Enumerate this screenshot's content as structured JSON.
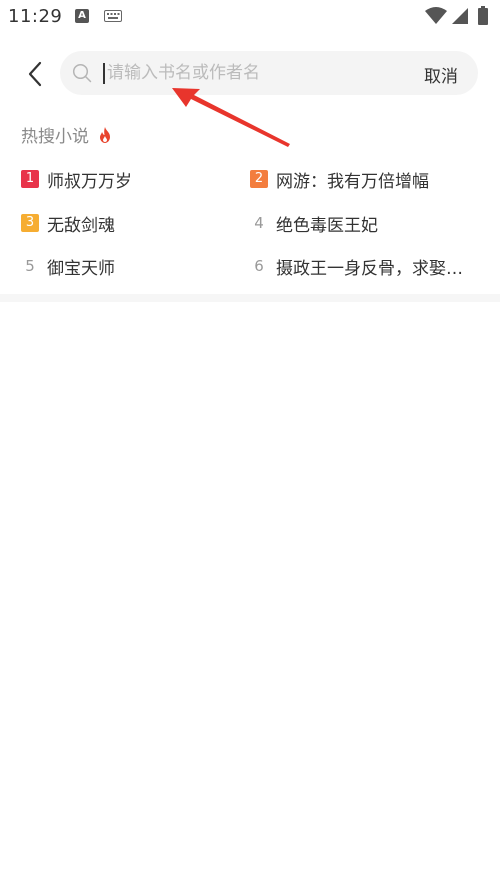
{
  "status_bar": {
    "time": "11:29",
    "app_icon_letter": "A",
    "icons": [
      "a-notification-icon",
      "keyboard-icon",
      "wifi-icon",
      "signal-icon",
      "battery-icon"
    ]
  },
  "search": {
    "placeholder": "请输入书名或作者名",
    "value": "",
    "cancel_label": "取消"
  },
  "hot": {
    "title": "热搜小说",
    "items": [
      {
        "rank": "1",
        "title": "师叔万万岁"
      },
      {
        "rank": "2",
        "title": "网游：我有万倍增幅"
      },
      {
        "rank": "3",
        "title": "无敌剑魂"
      },
      {
        "rank": "4",
        "title": "绝色毒医王妃"
      },
      {
        "rank": "5",
        "title": "御宝天师"
      },
      {
        "rank": "6",
        "title": "摄政王一身反骨，求娶…"
      }
    ]
  },
  "colors": {
    "rank1": "#e8334a",
    "rank2": "#f37d3e",
    "rank3": "#f6ad32",
    "annotation_arrow": "#e8352c"
  }
}
